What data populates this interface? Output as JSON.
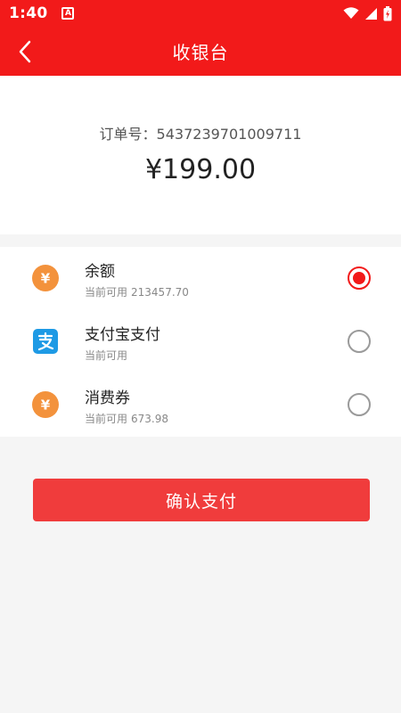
{
  "status_bar": {
    "time": "1:40",
    "notification_badge": "A"
  },
  "header": {
    "title": "收银台",
    "back_icon": "chevron-left-icon"
  },
  "order": {
    "order_label": "订单号：5437239701009711",
    "amount": "¥199.00"
  },
  "payment_methods": [
    {
      "name": "余额",
      "sub_label": "当前可用",
      "sub_value": "213457.70",
      "icon": "yuan-coin-icon",
      "selected": true
    },
    {
      "name": "支付宝支付",
      "sub_label": "当前可用",
      "sub_value": "",
      "icon": "alipay-icon",
      "selected": false
    },
    {
      "name": "消费券",
      "sub_label": "当前可用",
      "sub_value": "673.98",
      "icon": "yuan-coin-icon",
      "selected": false
    }
  ],
  "confirm_button": {
    "label": "确认支付"
  },
  "colors": {
    "brand_red": "#f21a1a",
    "button_red": "#f03c3c",
    "coin_orange": "#f3923c",
    "alipay_blue": "#1e9ae5"
  }
}
